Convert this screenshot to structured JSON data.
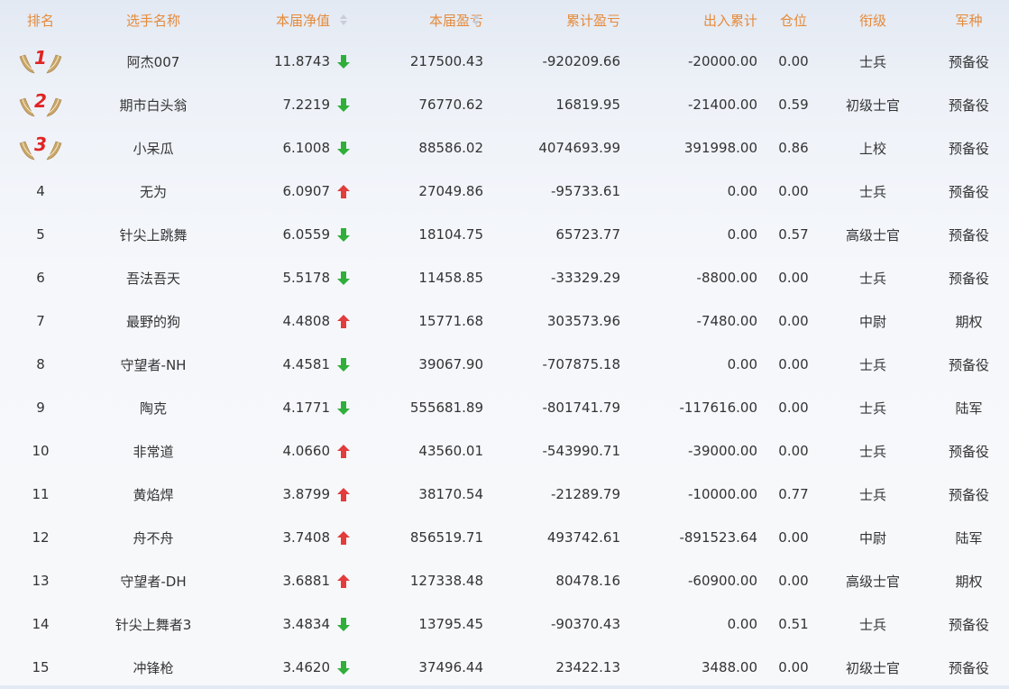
{
  "headers": {
    "rank": "排名",
    "name": "选手名称",
    "nav": "本届净值",
    "pnl": "本届盈亏",
    "cum": "累计盈亏",
    "io": "出入累计",
    "pos": "仓位",
    "grade": "衔级",
    "arm": "军种"
  },
  "colors": {
    "header_text": "#e58a3a",
    "up_arrow": "#e23c3c",
    "down_arrow": "#2fae3a",
    "medal_number": "#e02424",
    "medal_wing": "#c9a66a"
  },
  "rows": [
    {
      "rank": "1",
      "medal": true,
      "name": "阿杰007",
      "nav": "11.8743",
      "dir": "down",
      "pnl": "217500.43",
      "cum": "-920209.66",
      "io": "-20000.00",
      "pos": "0.00",
      "grade": "士兵",
      "arm": "预备役"
    },
    {
      "rank": "2",
      "medal": true,
      "name": "期市白头翁",
      "nav": "7.2219",
      "dir": "down",
      "pnl": "76770.62",
      "cum": "16819.95",
      "io": "-21400.00",
      "pos": "0.59",
      "grade": "初级士官",
      "arm": "预备役"
    },
    {
      "rank": "3",
      "medal": true,
      "name": "小呆瓜",
      "nav": "6.1008",
      "dir": "down",
      "pnl": "88586.02",
      "cum": "4074693.99",
      "io": "391998.00",
      "pos": "0.86",
      "grade": "上校",
      "arm": "预备役"
    },
    {
      "rank": "4",
      "medal": false,
      "name": "无为",
      "nav": "6.0907",
      "dir": "up",
      "pnl": "27049.86",
      "cum": "-95733.61",
      "io": "0.00",
      "pos": "0.00",
      "grade": "士兵",
      "arm": "预备役"
    },
    {
      "rank": "5",
      "medal": false,
      "name": "针尖上跳舞",
      "nav": "6.0559",
      "dir": "down",
      "pnl": "18104.75",
      "cum": "65723.77",
      "io": "0.00",
      "pos": "0.57",
      "grade": "高级士官",
      "arm": "预备役"
    },
    {
      "rank": "6",
      "medal": false,
      "name": "吾法吾天",
      "nav": "5.5178",
      "dir": "down",
      "pnl": "11458.85",
      "cum": "-33329.29",
      "io": "-8800.00",
      "pos": "0.00",
      "grade": "士兵",
      "arm": "预备役"
    },
    {
      "rank": "7",
      "medal": false,
      "name": "最野的狗",
      "nav": "4.4808",
      "dir": "up",
      "pnl": "15771.68",
      "cum": "303573.96",
      "io": "-7480.00",
      "pos": "0.00",
      "grade": "中尉",
      "arm": "期权"
    },
    {
      "rank": "8",
      "medal": false,
      "name": "守望者-NH",
      "nav": "4.4581",
      "dir": "down",
      "pnl": "39067.90",
      "cum": "-707875.18",
      "io": "0.00",
      "pos": "0.00",
      "grade": "士兵",
      "arm": "预备役"
    },
    {
      "rank": "9",
      "medal": false,
      "name": "陶克",
      "nav": "4.1771",
      "dir": "down",
      "pnl": "555681.89",
      "cum": "-801741.79",
      "io": "-117616.00",
      "pos": "0.00",
      "grade": "士兵",
      "arm": "陆军"
    },
    {
      "rank": "10",
      "medal": false,
      "name": "非常道",
      "nav": "4.0660",
      "dir": "up",
      "pnl": "43560.01",
      "cum": "-543990.71",
      "io": "-39000.00",
      "pos": "0.00",
      "grade": "士兵",
      "arm": "预备役"
    },
    {
      "rank": "11",
      "medal": false,
      "name": "黄焰焊",
      "nav": "3.8799",
      "dir": "up",
      "pnl": "38170.54",
      "cum": "-21289.79",
      "io": "-10000.00",
      "pos": "0.77",
      "grade": "士兵",
      "arm": "预备役"
    },
    {
      "rank": "12",
      "medal": false,
      "name": "舟不舟",
      "nav": "3.7408",
      "dir": "up",
      "pnl": "856519.71",
      "cum": "493742.61",
      "io": "-891523.64",
      "pos": "0.00",
      "grade": "中尉",
      "arm": "陆军"
    },
    {
      "rank": "13",
      "medal": false,
      "name": "守望者-DH",
      "nav": "3.6881",
      "dir": "up",
      "pnl": "127338.48",
      "cum": "80478.16",
      "io": "-60900.00",
      "pos": "0.00",
      "grade": "高级士官",
      "arm": "期权"
    },
    {
      "rank": "14",
      "medal": false,
      "name": "针尖上舞者3",
      "nav": "3.4834",
      "dir": "down",
      "pnl": "13795.45",
      "cum": "-90370.43",
      "io": "0.00",
      "pos": "0.51",
      "grade": "士兵",
      "arm": "预备役"
    },
    {
      "rank": "15",
      "medal": false,
      "name": "冲锋枪",
      "nav": "3.4620",
      "dir": "down",
      "pnl": "37496.44",
      "cum": "23422.13",
      "io": "3488.00",
      "pos": "0.00",
      "grade": "初级士官",
      "arm": "预备役"
    }
  ]
}
